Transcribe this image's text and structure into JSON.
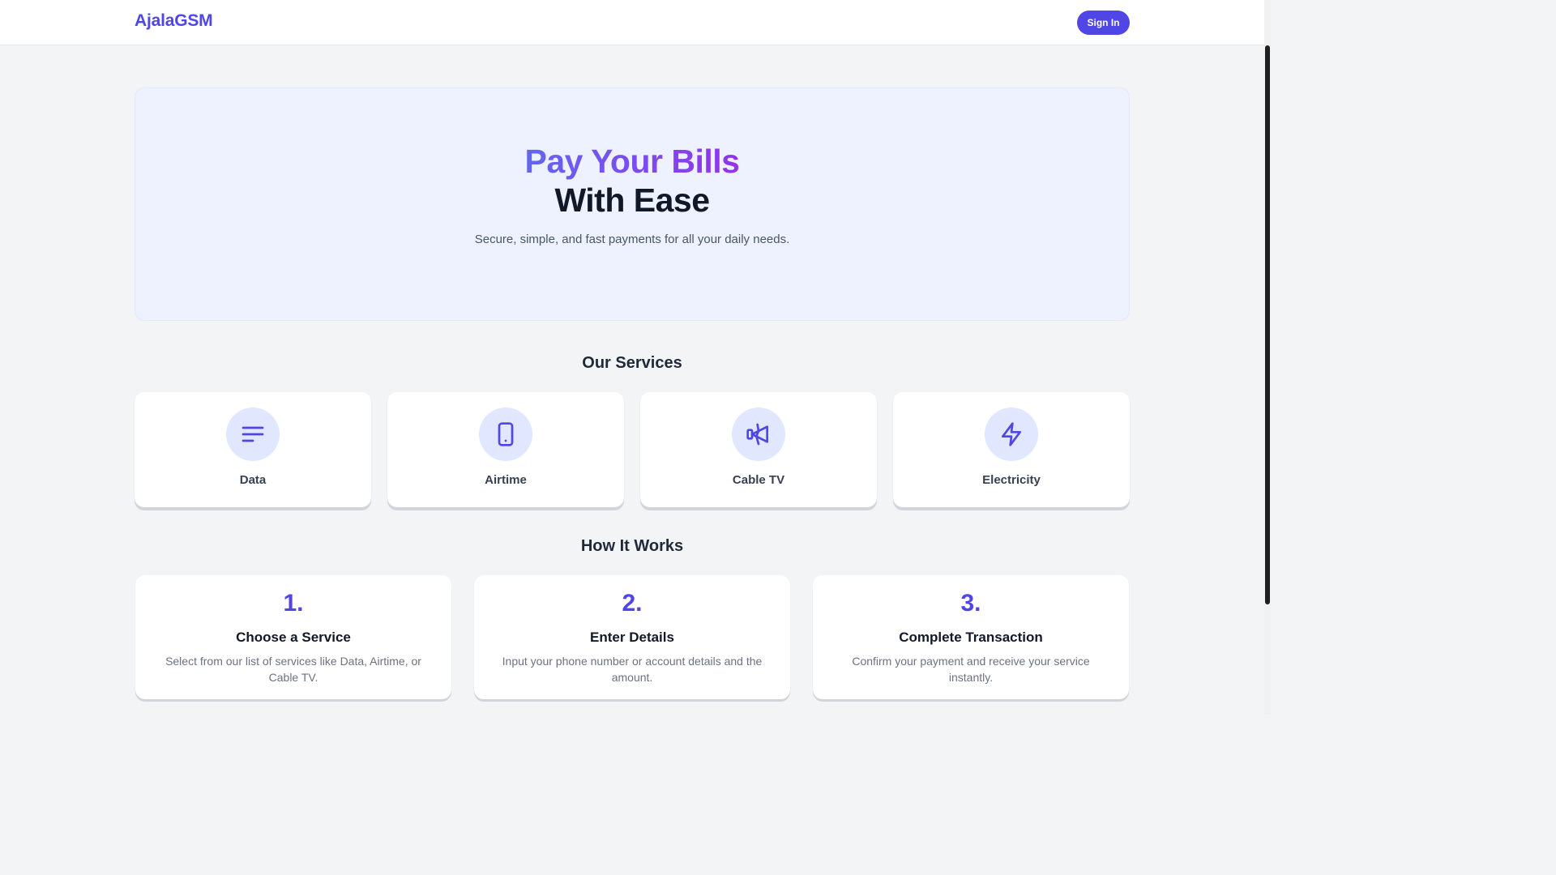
{
  "nav": {
    "logo": "AjalaGSM",
    "signin_label": "Sign In"
  },
  "hero": {
    "title_gradient": "Pay Your Bills",
    "title_plain": "With Ease",
    "subtitle": "Secure, simple, and fast payments for all your daily needs."
  },
  "services": {
    "title": "Our Services",
    "items": [
      {
        "label": "Data",
        "icon": "menu-lines-icon"
      },
      {
        "label": "Airtime",
        "icon": "smartphone-icon"
      },
      {
        "label": "Cable TV",
        "icon": "cable-tv-icon"
      },
      {
        "label": "Electricity",
        "icon": "lightning-bolt-icon"
      }
    ]
  },
  "how_it_works": {
    "title": "How It Works",
    "steps": [
      {
        "number": "1.",
        "title": "Choose a Service",
        "description": "Select from our list of services like Data, Airtime, or Cable TV."
      },
      {
        "number": "2.",
        "title": "Enter Details",
        "description": "Input your phone number or account details and the amount."
      },
      {
        "number": "3.",
        "title": "Complete Transaction",
        "description": "Confirm your payment and receive your service instantly."
      }
    ]
  },
  "colors": {
    "brand": "#4f46e5",
    "gradient_start": "#6366f1",
    "gradient_end": "#9333ea",
    "icon_bg": "#e0e7ff",
    "hero_bg": "#eef2ff",
    "page_bg": "#f3f4f6"
  }
}
